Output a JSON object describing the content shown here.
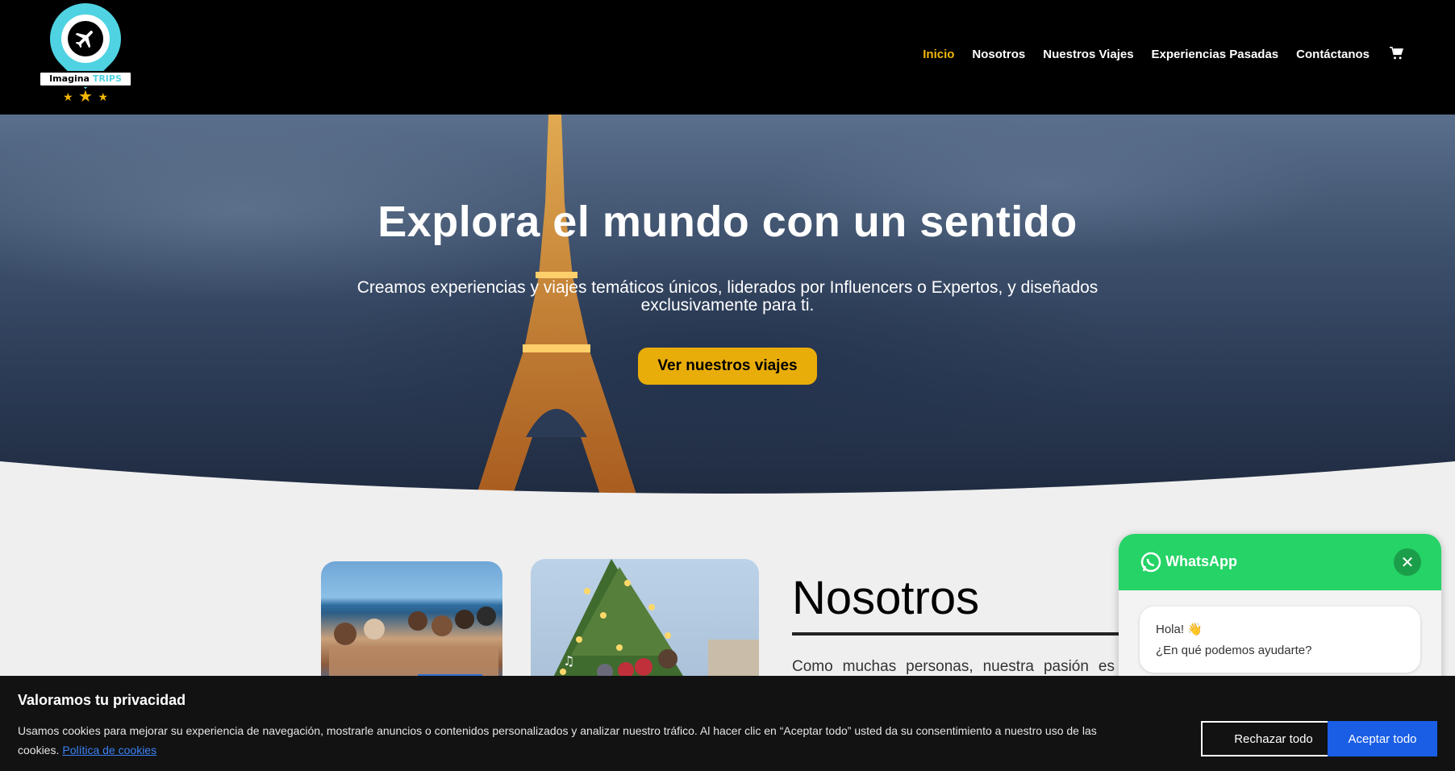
{
  "colors": {
    "accent": "#f2b705",
    "button": "#e9ad0a",
    "whatsapp": "#25d366",
    "cookie_accept": "#1a5ee6",
    "logo_pin": "#4fd3e2"
  },
  "logo": {
    "brand_left": "Imagina",
    "brand_right": "TRIPS",
    "icon": "plane-pin-icon"
  },
  "nav": {
    "items": [
      "Inicio",
      "Nosotros",
      "Nuestros Viajes",
      "Experiencias Pasadas",
      "Contáctanos"
    ],
    "active": "Inicio",
    "cart_icon": "cart-icon"
  },
  "hero": {
    "title": "Explora el mundo con un sentido",
    "subtitle": "Creamos experiencias y viajes temáticos únicos, liderados por Influencers o Expertos, y diseñados exclusivamente para ti.",
    "button": "Ver nuestros viajes"
  },
  "about": {
    "title": "Nosotros",
    "text": "Como muchas personas, nuestra pasión es"
  },
  "whatsapp": {
    "title": "WhatsApp",
    "greeting": "Hola! 👋",
    "question": "¿En qué podemos ayudarte?",
    "close_icon": "close-icon"
  },
  "cookies": {
    "title": "Valoramos tu privacidad",
    "text": "Usamos cookies para mejorar su experiencia de navegación, mostrarle anuncios o contenidos personalizados y analizar nuestro tráfico. Al hacer clic en “Aceptar todo” usted da su consentimiento a nuestro uso de las cookies.",
    "policy_link": "Política de cookies",
    "reject": "Rechazar todo",
    "accept": "Aceptar todo"
  }
}
